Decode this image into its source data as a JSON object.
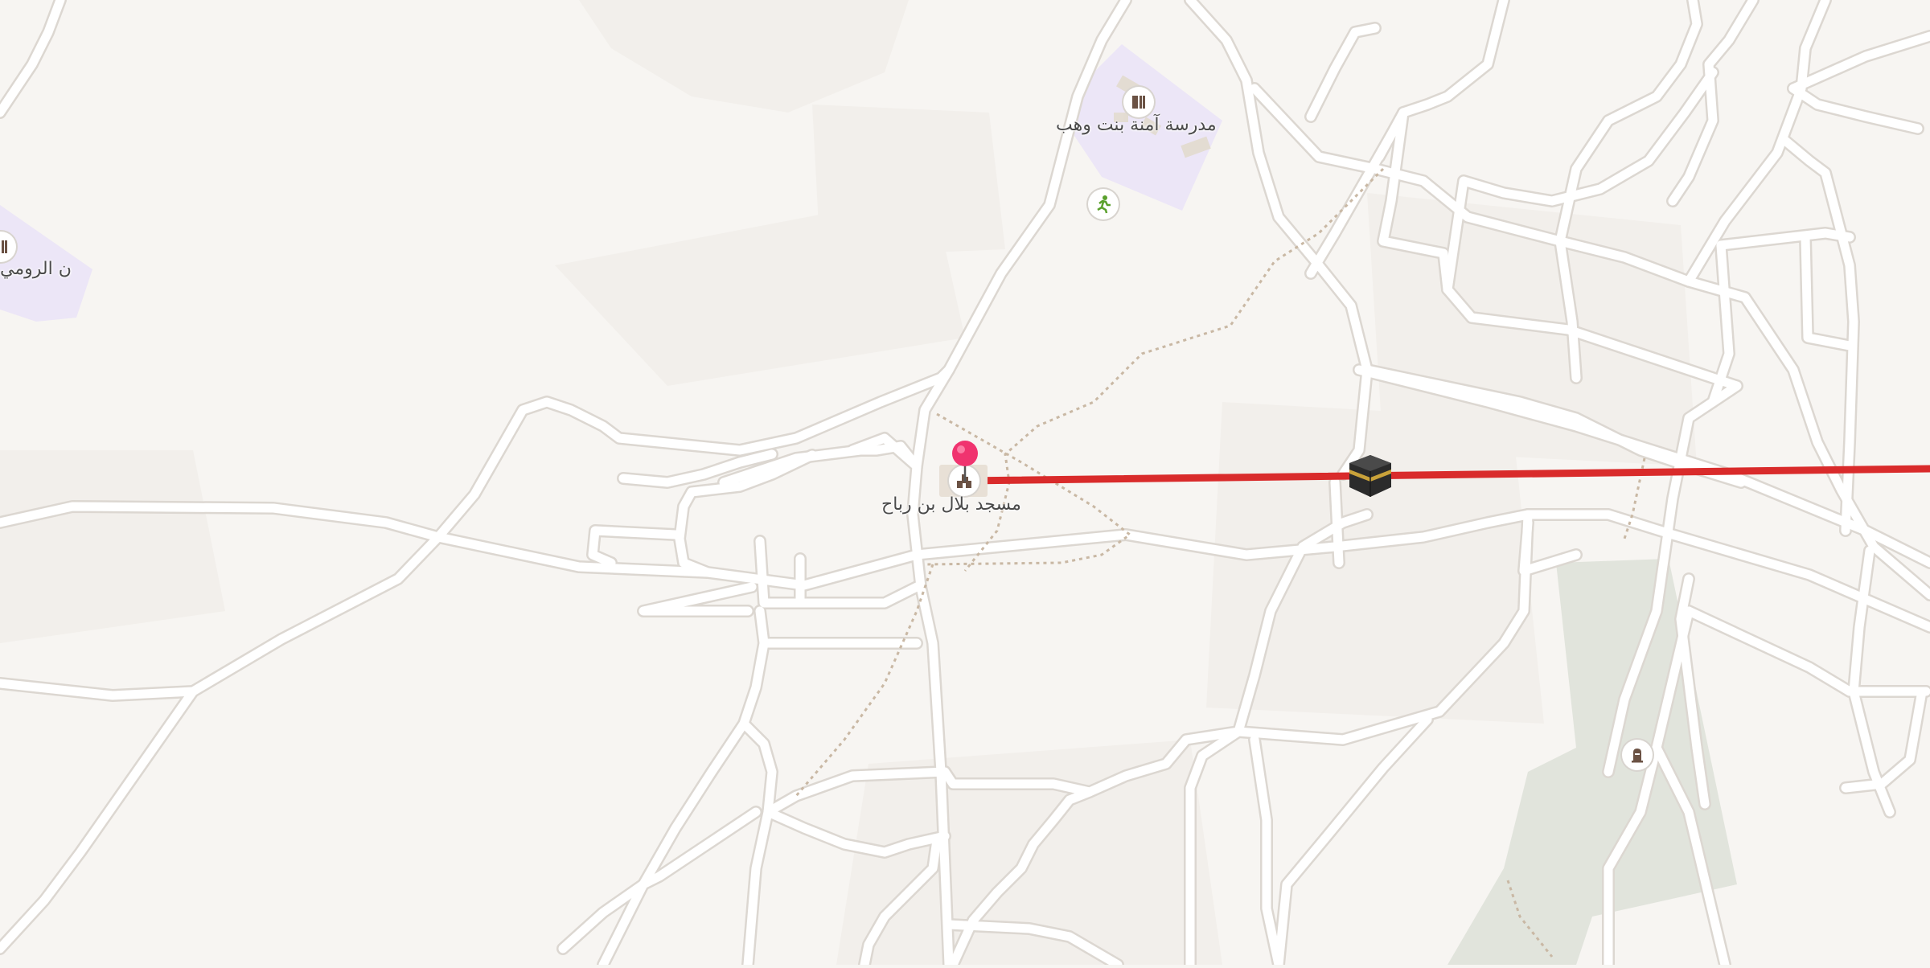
{
  "map": {
    "colors": {
      "land": "#f7f5f2",
      "block": "#f1eeea",
      "road_fill": "#ffffff",
      "road_casing": "#dcd7d1",
      "school_area": "#ece6f7",
      "park_area": "#e1e4dc",
      "path": "#c9b8a4",
      "route_line": "#d92b2b",
      "pin": "#f0336f"
    },
    "labels": {
      "school": "مدرسة آمنة بنت وهب",
      "mosque": "مسجد بلال بن رباح",
      "left_school_partial": "ن الرومي"
    },
    "icons": {
      "school": "school-icon",
      "sports": "running-person-icon",
      "mosque": "mosque-icon",
      "kaaba": "kaaba-icon",
      "cemetery": "tombstone-icon",
      "pin": "location-pin-icon"
    }
  }
}
